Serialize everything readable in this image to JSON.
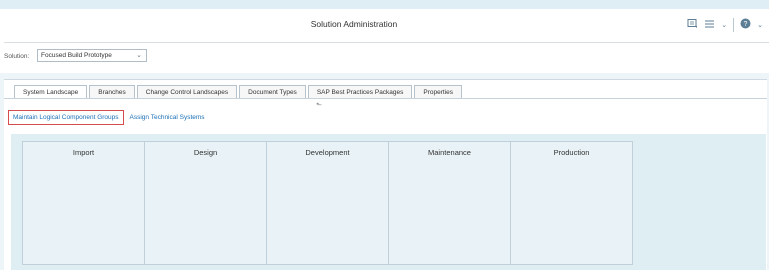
{
  "shell": {
    "title": "Solution Administration",
    "icons": [
      "notification-icon",
      "list-menu-icon",
      "chevron-down-icon",
      "help-icon",
      "chevron-down-icon"
    ]
  },
  "filter": {
    "solution_label": "Solution:",
    "solution_value": "Focused Build Prototype"
  },
  "tabs": [
    {
      "label": "System Landscape",
      "active": true
    },
    {
      "label": "Branches",
      "active": false
    },
    {
      "label": "Change Control Landscapes",
      "active": false
    },
    {
      "label": "Document Types",
      "active": false
    },
    {
      "label": "SAP Best Practices Packages",
      "active": false
    },
    {
      "label": "Properties",
      "active": false
    }
  ],
  "subnav": {
    "maintain_label": "Maintain Logical Component Groups",
    "assign_label": "Assign Technical Systems"
  },
  "landscape": {
    "columns": [
      "Import",
      "Design",
      "Development",
      "Maintenance",
      "Production"
    ]
  },
  "colors": {
    "accent": "#1b6fb4",
    "highlight_border": "#d64b4b",
    "landscape_bg": "#dfeef3"
  }
}
